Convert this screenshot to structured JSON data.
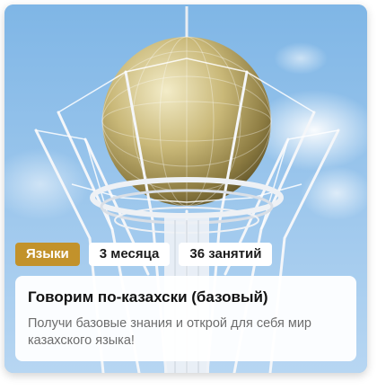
{
  "card": {
    "image_name": "bayterek-tower-photo",
    "tags": [
      "Языки",
      "3 месяца",
      "36 занятий"
    ],
    "title": "Говорим по-казахски (базовый)",
    "description": "Получи базовые знания и открой для себя мир казахского языка!"
  },
  "colors": {
    "accent_tag": "#c2922b",
    "sky": "#9cc6ec",
    "title_text": "#111111",
    "description_text": "#6d6d6d"
  }
}
